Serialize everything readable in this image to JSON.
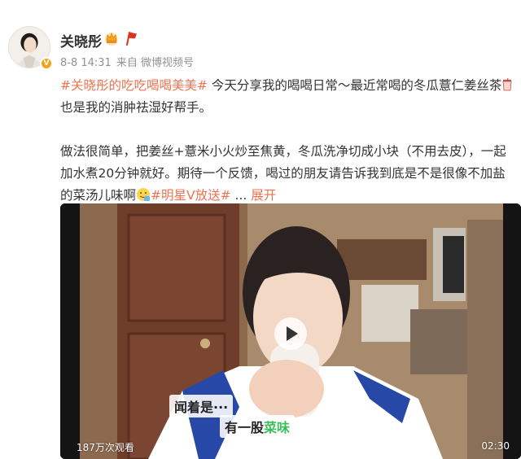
{
  "author": {
    "name": "关晓彤",
    "verified_badge": "V"
  },
  "meta": {
    "time": "8-8 14:31",
    "source": "来自 微博视频号"
  },
  "post": {
    "hashtag1": "#关晓彤的吃吃喝喝美美#",
    "line1_text": " 今天分享我的喝喝日常～最近常喝的冬瓜薏仁姜丝茶",
    "line2_text": "也是我的消肿祛湿好帮手。",
    "paragraph2": "做法很简单，把姜丝+薏米小火炒至焦黄，冬瓜洗净切成小块（不用去皮），一起加水煮20分钟就好。期待一个反馈，喝过的朋友请告诉我到底是不是很像不加盐的菜汤儿味啊",
    "hashtag2": "#明星V放送#",
    "ellipsis": " ... ",
    "expand_label": "展开"
  },
  "video": {
    "subtitle_line1": "闻着是···",
    "subtitle_line2_prefix": "有一股",
    "subtitle_line2_highlight": "菜味",
    "view_count": "187万次观看",
    "duration": "02:30"
  },
  "colors": {
    "accent": "#eb7350",
    "verified": "#f7a21a",
    "meta_gray": "#939393",
    "subtitle_highlight": "#3cc05a"
  },
  "icons": [
    "crown-badge-icon",
    "red-flag-icon",
    "drink-cup-emoji-icon",
    "smiling-face-emoji-icon",
    "play-icon"
  ]
}
